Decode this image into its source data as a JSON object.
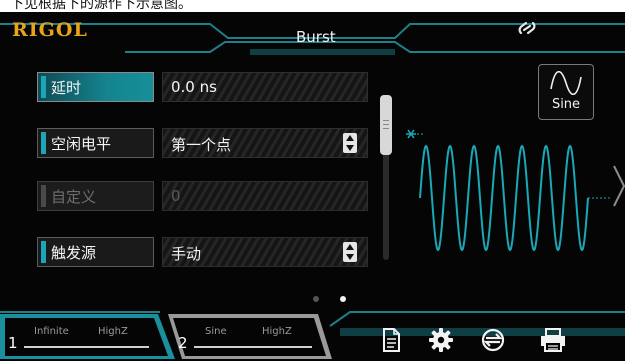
{
  "caption_fragment": "下见根据下的源作下示意图。",
  "header": {
    "logo": "RIGOL",
    "title": "Burst",
    "link_icon": "link-icon"
  },
  "params": [
    {
      "label": "延时",
      "value": "0.0 ns",
      "state": "active",
      "has_spinner": false
    },
    {
      "label": "空闲电平",
      "value": "第一个点",
      "state": "normal",
      "has_spinner": true
    },
    {
      "label": "自定义",
      "value": "0",
      "state": "disabled",
      "has_spinner": false
    },
    {
      "label": "触发源",
      "value": "手动",
      "state": "normal",
      "has_spinner": true
    }
  ],
  "waveform": {
    "button_label": "Sine",
    "icon": "sine-wave-icon"
  },
  "pager": {
    "pages": 2,
    "current": 2
  },
  "channels": [
    {
      "number": "1",
      "left": "Infinite",
      "right": "HighZ",
      "active": true
    },
    {
      "number": "2",
      "left": "Sine",
      "right": "HighZ",
      "active": false
    }
  ],
  "toolbar": [
    {
      "icon": "document-icon"
    },
    {
      "icon": "gear-icon"
    },
    {
      "icon": "sync-icon"
    },
    {
      "icon": "printer-icon"
    }
  ],
  "colors": {
    "accent": "#17a2b1",
    "logo": "#e8a51c",
    "background": "#050505"
  }
}
